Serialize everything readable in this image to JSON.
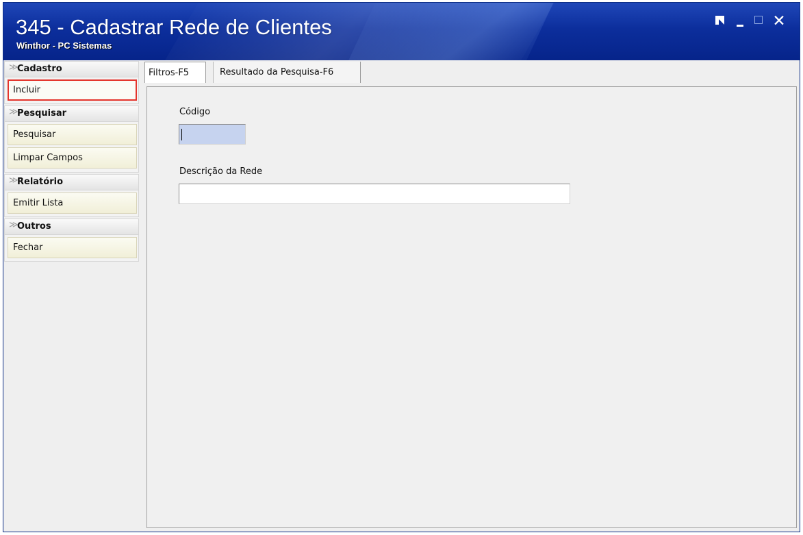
{
  "window": {
    "title": "345 - Cadastrar Rede de Clientes",
    "subtitle": "Winthor - PC Sistemas",
    "controls": {
      "close_glyph": "✕"
    }
  },
  "sidebar": {
    "groups": [
      {
        "title": "Cadastro",
        "items": [
          "Incluir"
        ]
      },
      {
        "title": "Pesquisar",
        "items": [
          "Pesquisar",
          "Limpar Campos"
        ]
      },
      {
        "title": "Relatório",
        "items": [
          "Emitir Lista"
        ]
      },
      {
        "title": "Outros",
        "items": [
          "Fechar"
        ]
      }
    ],
    "chevron": "≫",
    "active_item": "Incluir"
  },
  "tabs": [
    {
      "label": "Filtros-F5",
      "active": true
    },
    {
      "label": "Resultado da Pesquisa-F6",
      "active": false
    }
  ],
  "form": {
    "codigo": {
      "label": "Código",
      "value": ""
    },
    "descricao": {
      "label": "Descrição da  Rede",
      "value": ""
    }
  },
  "colors": {
    "titlebar": "#0c2e9c",
    "highlight": "#e4342c",
    "focused_input": "#c6d3ef"
  }
}
